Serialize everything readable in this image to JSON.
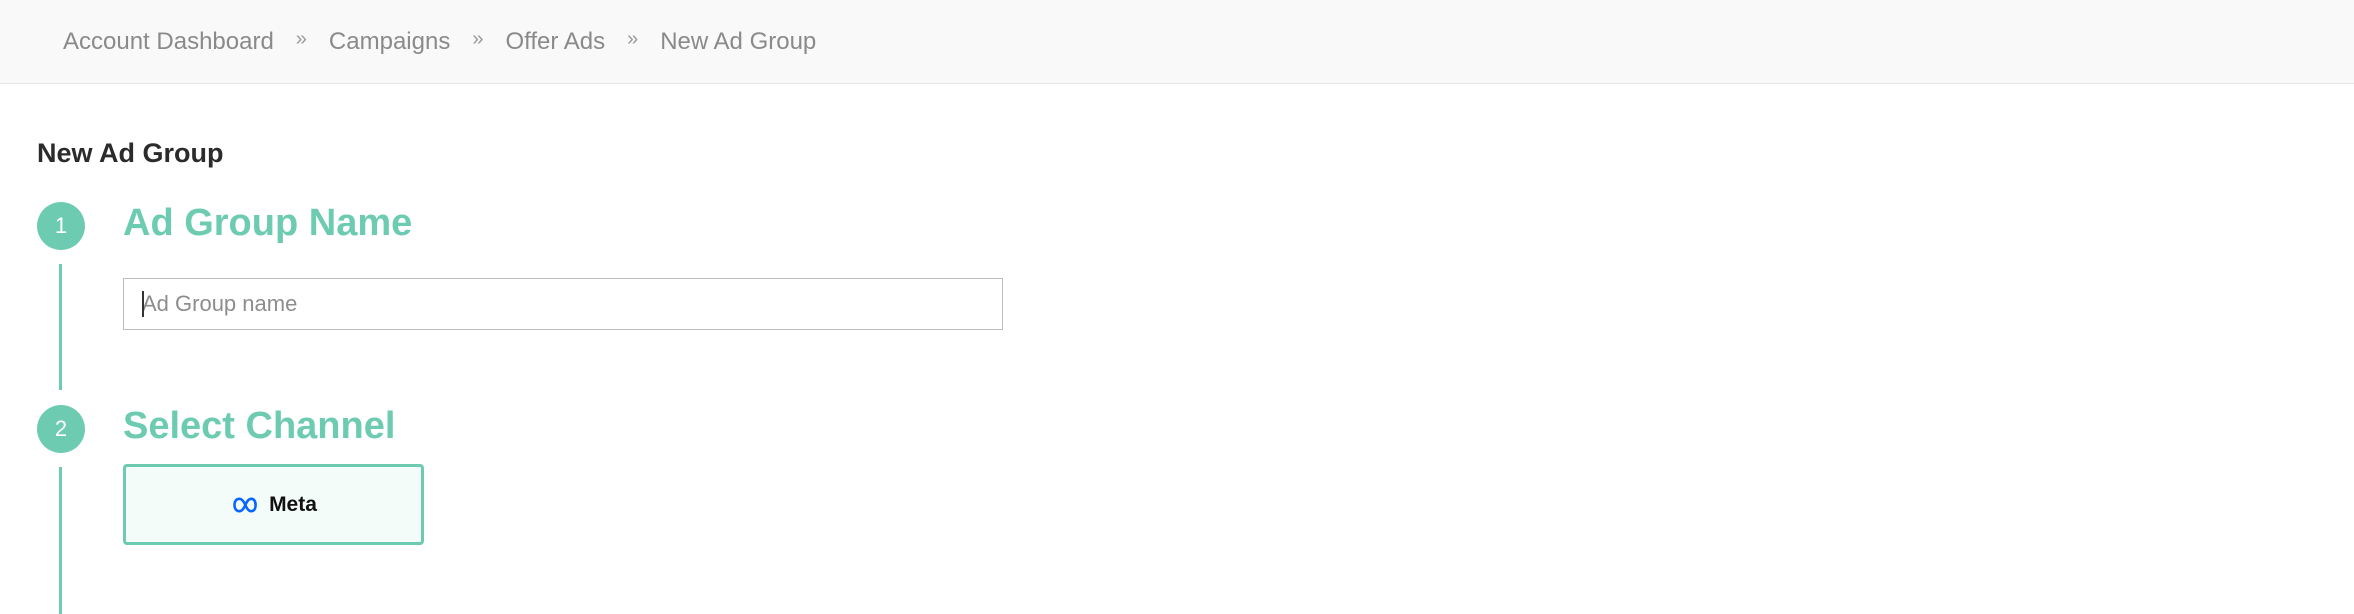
{
  "breadcrumb": {
    "items": [
      {
        "label": "Account Dashboard"
      },
      {
        "label": "Campaigns"
      },
      {
        "label": "Offer Ads"
      },
      {
        "label": "New Ad Group"
      }
    ],
    "separator": "»"
  },
  "page": {
    "title": "New Ad Group"
  },
  "steps": [
    {
      "number": "1",
      "title": "Ad Group Name",
      "input": {
        "value": "",
        "placeholder": "Ad Group name"
      }
    },
    {
      "number": "2",
      "title": "Select Channel",
      "channels": [
        {
          "label": "Meta",
          "icon": "meta-icon"
        }
      ]
    }
  ],
  "colors": {
    "accent": "#6dcbb1",
    "card_bg": "#f3fcf9",
    "meta_blue": "#0866ff"
  }
}
